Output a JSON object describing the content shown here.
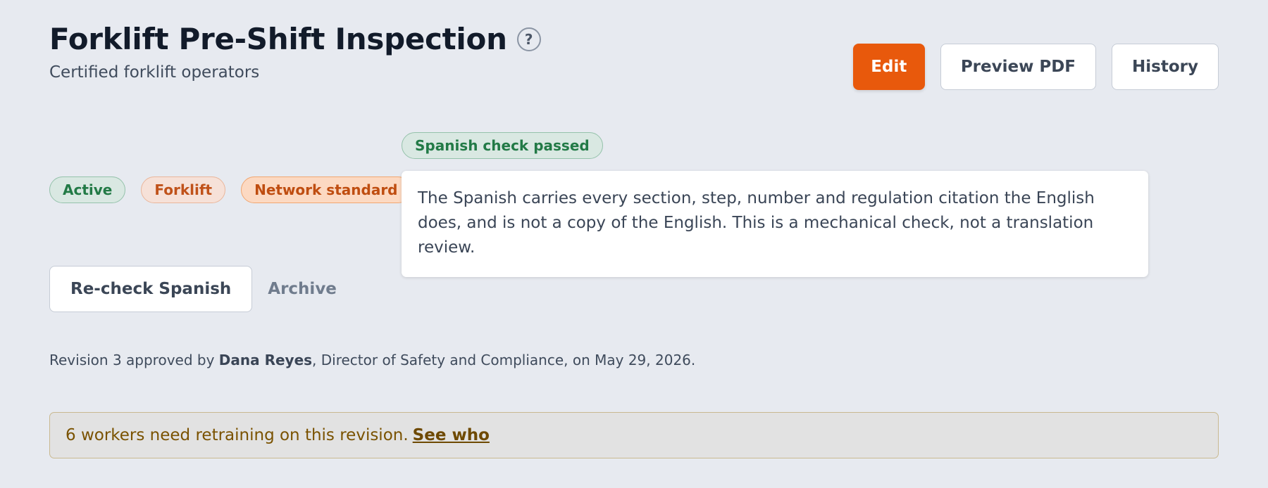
{
  "header": {
    "title": "Forklift Pre-Shift Inspection",
    "help_glyph": "?",
    "subtitle": "Certified forklift operators"
  },
  "actions": {
    "edit_label": "Edit",
    "preview_label": "Preview PDF",
    "history_label": "History"
  },
  "badges": [
    {
      "label": "Active",
      "tone": "green"
    },
    {
      "label": "Forklift",
      "tone": "peach"
    },
    {
      "label": "Network standard",
      "tone": "orange"
    }
  ],
  "spanish_check": {
    "badge": "Spanish check passed",
    "description": "The Spanish carries every section, step, number and regulation citation the English does, and is not a copy of the English. This is a mechanical check, not a translation review."
  },
  "secondary_actions": {
    "recheck_label": "Re-check Spanish",
    "archive_label": "Archive"
  },
  "revision": {
    "prefix": "Revision 3 approved by ",
    "approver": "Dana Reyes",
    "suffix": ", Director of Safety and Compliance, on May 29, 2026."
  },
  "retraining": {
    "message": "6 workers need retraining on this revision.",
    "link_label": "See who"
  },
  "colors": {
    "background": "#e7eaf0",
    "primary": "#e8590c",
    "success": "#227a46",
    "warning_text": "#7a5200"
  }
}
